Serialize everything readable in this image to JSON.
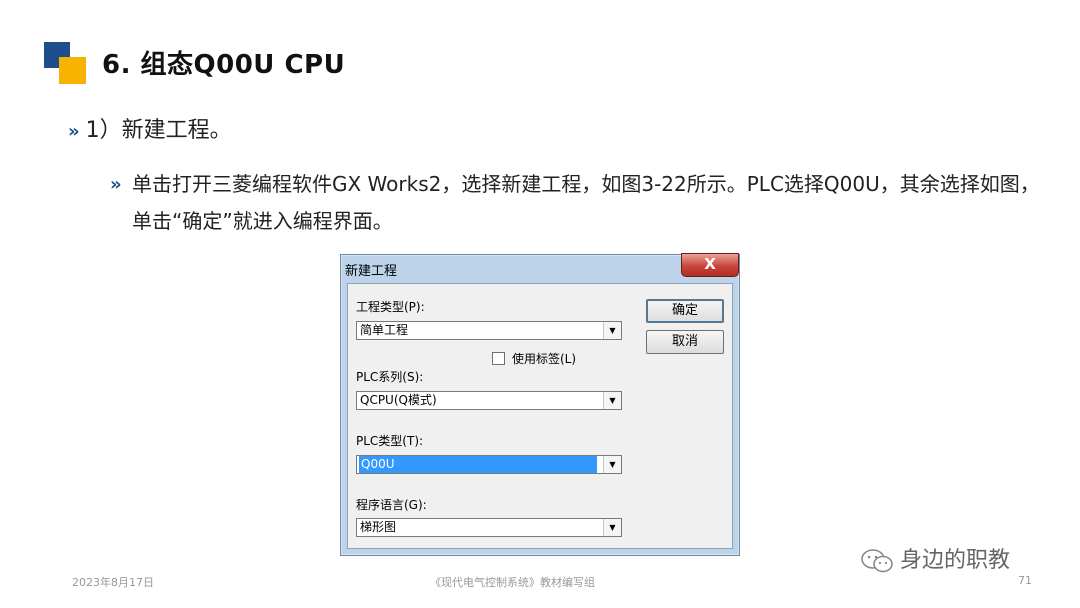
{
  "slide": {
    "title": "6. 组态Q00U CPU",
    "bullet1": "1）新建工程。",
    "bullet2": "单击打开三菱编程软件GX Works2，选择新建工程，如图3-22所示。PLC选择Q00U，其余选择如图，单击“确定”就进入编程界面。",
    "chevron": "»",
    "colors": {
      "accent_blue": "#1f4e8c",
      "accent_yellow": "#f7b300"
    }
  },
  "dialog": {
    "title": "新建工程",
    "close_glyph": "X",
    "project_type_label": "工程类型(P):",
    "project_type_value": "简单工程",
    "use_label_text": "使用标签(L)",
    "use_label_checked": false,
    "plc_series_label": "PLC系列(S):",
    "plc_series_value": "QCPU(Q模式)",
    "plc_type_label": "PLC类型(T):",
    "plc_type_value": "Q00U",
    "language_label": "程序语言(G):",
    "language_value": "梯形图",
    "ok_label": "确定",
    "cancel_label": "取消",
    "dropdown_glyph": "▼"
  },
  "footer": {
    "date": "2023年8月17日",
    "source": "《现代电气控制系统》教材编写组",
    "page": "71",
    "watermark": "身边的职教"
  }
}
